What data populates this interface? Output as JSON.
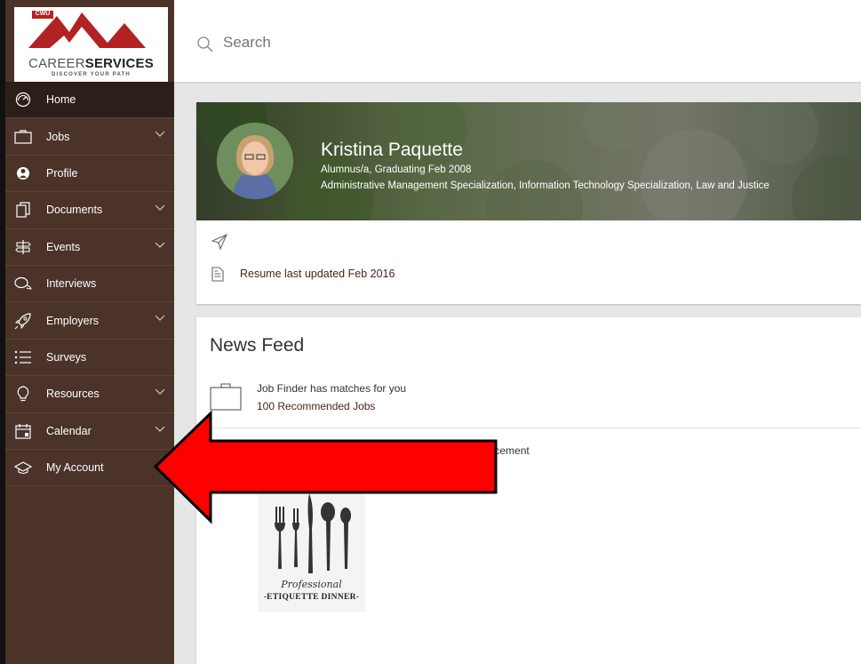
{
  "logo": {
    "badge": "CWU",
    "career": "CAREER",
    "services": "SERVICES",
    "tagline": "DISCOVER YOUR PATH"
  },
  "search": {
    "placeholder": "Search"
  },
  "sidebar": {
    "items": [
      {
        "label": "Home",
        "icon": "dashboard-icon",
        "expandable": false,
        "active": true
      },
      {
        "label": "Jobs",
        "icon": "briefcase-icon",
        "expandable": true
      },
      {
        "label": "Profile",
        "icon": "profile-icon",
        "expandable": false
      },
      {
        "label": "Documents",
        "icon": "documents-icon",
        "expandable": true
      },
      {
        "label": "Events",
        "icon": "signpost-icon",
        "expandable": true
      },
      {
        "label": "Interviews",
        "icon": "chat-bubbles-icon",
        "expandable": false
      },
      {
        "label": "Employers",
        "icon": "rocket-icon",
        "expandable": true
      },
      {
        "label": "Surveys",
        "icon": "list-icon",
        "expandable": false
      },
      {
        "label": "Resources",
        "icon": "lightbulb-icon",
        "expandable": true
      },
      {
        "label": "Calendar",
        "icon": "calendar-icon",
        "expandable": true
      },
      {
        "label": "My Account",
        "icon": "graduation-cap-icon",
        "expandable": false
      }
    ]
  },
  "profile": {
    "name": "Kristina Paquette",
    "status": "Alumnus/a, Graduating Feb 2008",
    "majors": "Administrative Management Specialization, Information Technology Specialization, Law and Justice",
    "resume_link": "Resume last updated Feb 2016"
  },
  "news_feed": {
    "title": "News Feed",
    "job_finder": {
      "text": "Job Finder has matches for you",
      "link": "100 Recommended Jobs"
    },
    "announcement_text": "nnouncement",
    "event_image": {
      "script_text": "Professional",
      "title_text": "-ETIQUETTE DINNER-"
    }
  },
  "colors": {
    "sidebar_bg": "#4b3329",
    "sidebar_active": "#2c1f19",
    "link_color": "#4b2418",
    "logo_red": "#b22222",
    "arrow_red": "#ff0000"
  }
}
